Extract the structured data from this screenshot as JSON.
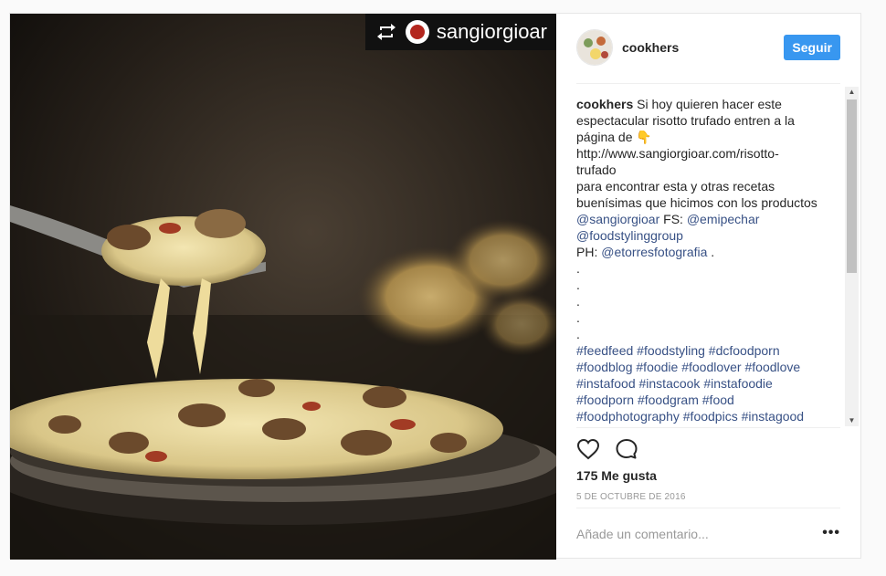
{
  "repost": {
    "username": "sangiorgioar"
  },
  "header": {
    "username": "cookhers",
    "follow_label": "Seguir"
  },
  "caption": {
    "author": "cookhers",
    "line1": " Si hoy quieren hacer este\nespectacular risotto trufado entren a la\npágina de ",
    "pointer_emoji": "👇",
    "line2": "\nhttp://www.sangiorgioar.com/risotto-\ntrufado\npara encontrar esta y otras recetas\nbuenísimas que hicimos con los productos\n",
    "mention1": "@sangiorgioar",
    "fs": " FS: ",
    "mention2": "@emipechar",
    "nl1": "\n",
    "mention3": "@foodstylinggroup",
    "ph": "\nPH: ",
    "mention4": "@etorresfotografia",
    "dots": " .\n.\n.\n.\n.\n.\n",
    "hashtags": "#feedfeed #foodstyling #dcfoodporn\n#foodblog #foodie #foodlover #foodlove\n#instafood #instacook #instafoodie\n#foodporn #foodgram #food\n#foodphotography #foodpics #instagood"
  },
  "likes": "175 Me gusta",
  "date": "5 DE OCTUBRE DE 2016",
  "comment_placeholder": "Añade un comentario...",
  "more_label": "•••",
  "icons": {
    "like": "heart-icon",
    "comment": "comment-icon",
    "repost": "repost-icon"
  }
}
